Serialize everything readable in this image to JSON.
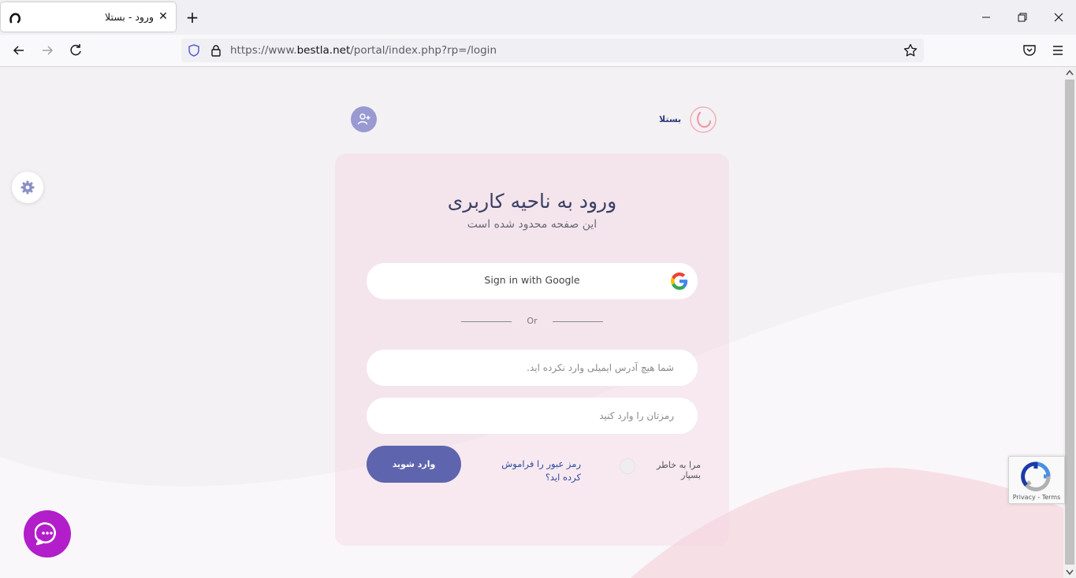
{
  "browser": {
    "tab": {
      "title": "ورود - بستلا",
      "close_icon": "close-icon",
      "favicon": "site-favicon"
    },
    "new_tab_symbol": "+",
    "url": {
      "prefix": "https://www.",
      "host": "bestla.net",
      "path": "/portal/index.php?rp=/login"
    }
  },
  "header": {
    "brand": "بستلا",
    "brand_color": "#2f3a7a"
  },
  "login": {
    "title": "ورود به ناحیه کاربری",
    "subtitle": "این صفحه محدود شده است",
    "google_label": "Sign in with Google",
    "or_label": "Or",
    "email_placeholder": "شما هیچ آدرس ایمیلی وارد نکرده اید.",
    "password_placeholder": "رمزتان را وارد کنید",
    "submit_label": "وارد شوید",
    "forgot_label": "رمز عبور را فراموش کرده اید؟",
    "remember_label": "مرا به خاطر بسپار",
    "accent_color": "#5e64ad"
  },
  "recaptcha": {
    "terms": "Privacy - Terms"
  },
  "colors": {
    "chat_button": "#b21ec9",
    "register_button": "#9a9ad2"
  }
}
